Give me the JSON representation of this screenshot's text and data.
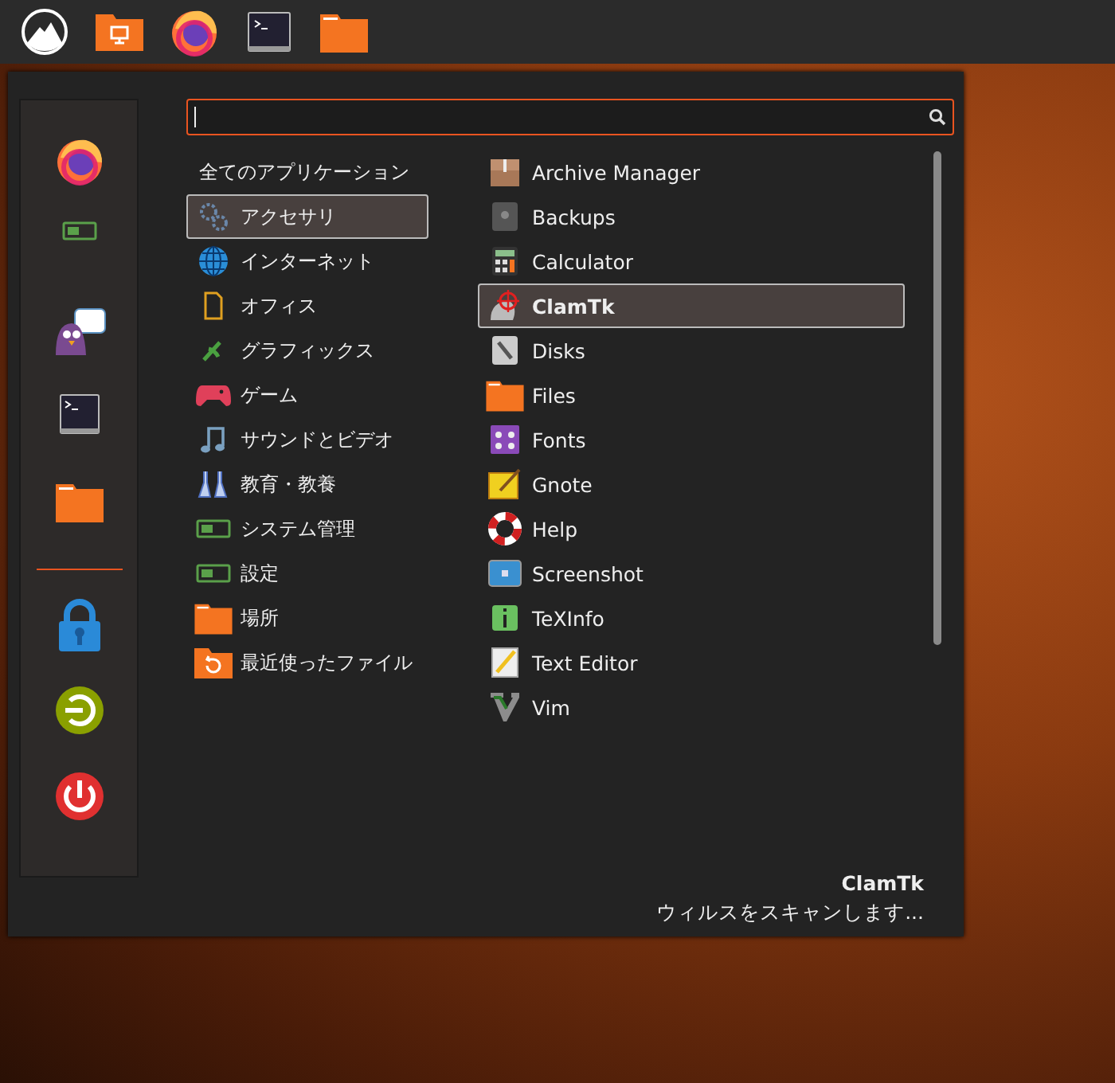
{
  "search": {
    "focused": true
  },
  "categories": [
    {
      "label": "全てのアプリケーション",
      "selected": false
    },
    {
      "label": "アクセサリ",
      "selected": true
    },
    {
      "label": "インターネット",
      "selected": false
    },
    {
      "label": "オフィス",
      "selected": false
    },
    {
      "label": "グラフィックス",
      "selected": false
    },
    {
      "label": "ゲーム",
      "selected": false
    },
    {
      "label": "サウンドとビデオ",
      "selected": false
    },
    {
      "label": "教育・教養",
      "selected": false
    },
    {
      "label": "システム管理",
      "selected": false
    },
    {
      "label": "設定",
      "selected": false
    },
    {
      "label": "場所",
      "selected": false
    },
    {
      "label": "最近使ったファイル",
      "selected": false
    }
  ],
  "applications": [
    {
      "label": "Archive Manager",
      "selected": false
    },
    {
      "label": "Backups",
      "selected": false
    },
    {
      "label": "Calculator",
      "selected": false
    },
    {
      "label": "ClamTk",
      "selected": true
    },
    {
      "label": "Disks",
      "selected": false
    },
    {
      "label": "Files",
      "selected": false
    },
    {
      "label": "Fonts",
      "selected": false
    },
    {
      "label": "Gnote",
      "selected": false
    },
    {
      "label": "Help",
      "selected": false
    },
    {
      "label": "Screenshot",
      "selected": false
    },
    {
      "label": "TeXInfo",
      "selected": false
    },
    {
      "label": "Text Editor",
      "selected": false
    },
    {
      "label": "Vim",
      "selected": false
    }
  ],
  "description": {
    "title": "ClamTk",
    "text": "ウィルスをスキャンします..."
  }
}
